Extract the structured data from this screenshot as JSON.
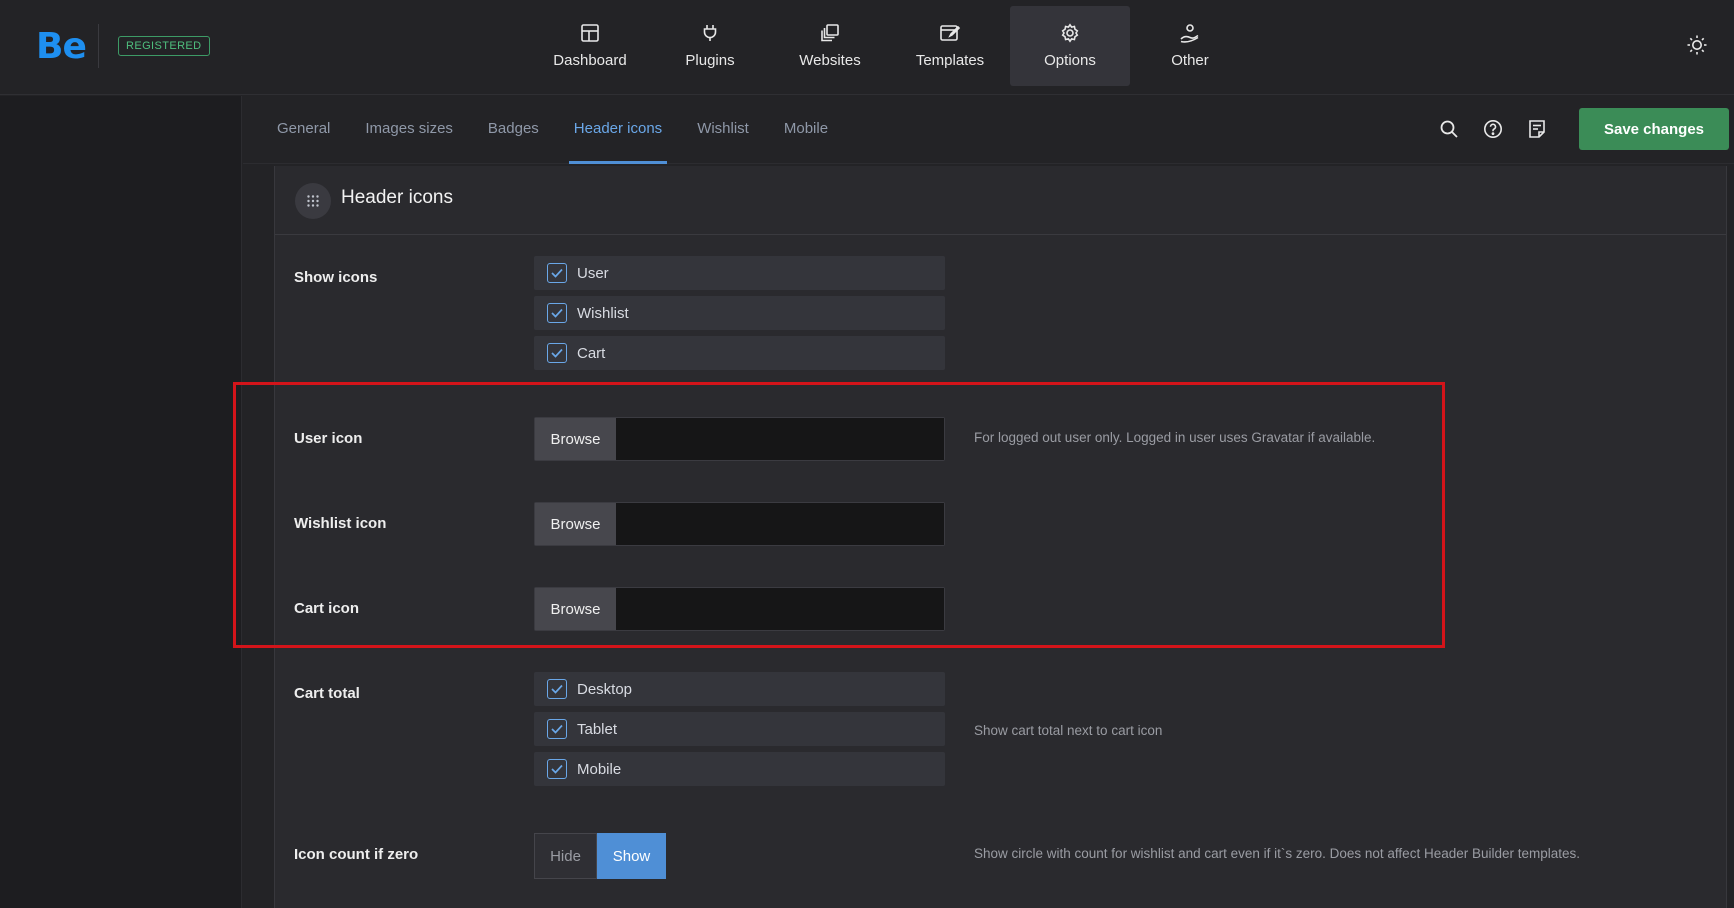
{
  "header": {
    "logo": "Be",
    "badge": "REGISTERED",
    "nav": [
      {
        "label": "Dashboard",
        "icon": "dashboard-icon",
        "active": false
      },
      {
        "label": "Plugins",
        "icon": "plug-icon",
        "active": false
      },
      {
        "label": "Websites",
        "icon": "websites-icon",
        "active": false
      },
      {
        "label": "Templates",
        "icon": "templates-icon",
        "active": false
      },
      {
        "label": "Options",
        "icon": "gear-icon",
        "active": true
      },
      {
        "label": "Other",
        "icon": "person-hand-icon",
        "active": false
      }
    ],
    "theme_icon": "sun-icon"
  },
  "subnav": {
    "tabs": [
      {
        "label": "General",
        "active": false
      },
      {
        "label": "Images sizes",
        "active": false
      },
      {
        "label": "Badges",
        "active": false
      },
      {
        "label": "Header icons",
        "active": true
      },
      {
        "label": "Wishlist",
        "active": false
      },
      {
        "label": "Mobile",
        "active": false
      }
    ],
    "tools": [
      "search-icon",
      "help-icon",
      "notes-icon"
    ],
    "save_label": "Save changes"
  },
  "panel": {
    "title": "Header icons",
    "show_icons": {
      "label": "Show icons",
      "options": [
        {
          "label": "User",
          "checked": true
        },
        {
          "label": "Wishlist",
          "checked": true
        },
        {
          "label": "Cart",
          "checked": true
        }
      ]
    },
    "user_icon": {
      "label": "User icon",
      "button": "Browse",
      "value": "",
      "hint": "For logged out user only. Logged in user uses Gravatar if available."
    },
    "wishlist_icon": {
      "label": "Wishlist icon",
      "button": "Browse",
      "value": ""
    },
    "cart_icon": {
      "label": "Cart icon",
      "button": "Browse",
      "value": ""
    },
    "cart_total": {
      "label": "Cart total",
      "options": [
        {
          "label": "Desktop",
          "checked": true
        },
        {
          "label": "Tablet",
          "checked": true
        },
        {
          "label": "Mobile",
          "checked": true
        }
      ],
      "hint": "Show cart total next to cart icon"
    },
    "icon_count": {
      "label": "Icon count if zero",
      "options": [
        "Hide",
        "Show"
      ],
      "selected": "Show",
      "hint": "Show circle with count for wishlist and cart even if it`s zero. Does not affect Header Builder templates."
    }
  },
  "colors": {
    "accent": "#4f8fd6",
    "save": "#3b8c57",
    "highlight_box": "#d3141a",
    "logo": "#1e8ff0"
  }
}
